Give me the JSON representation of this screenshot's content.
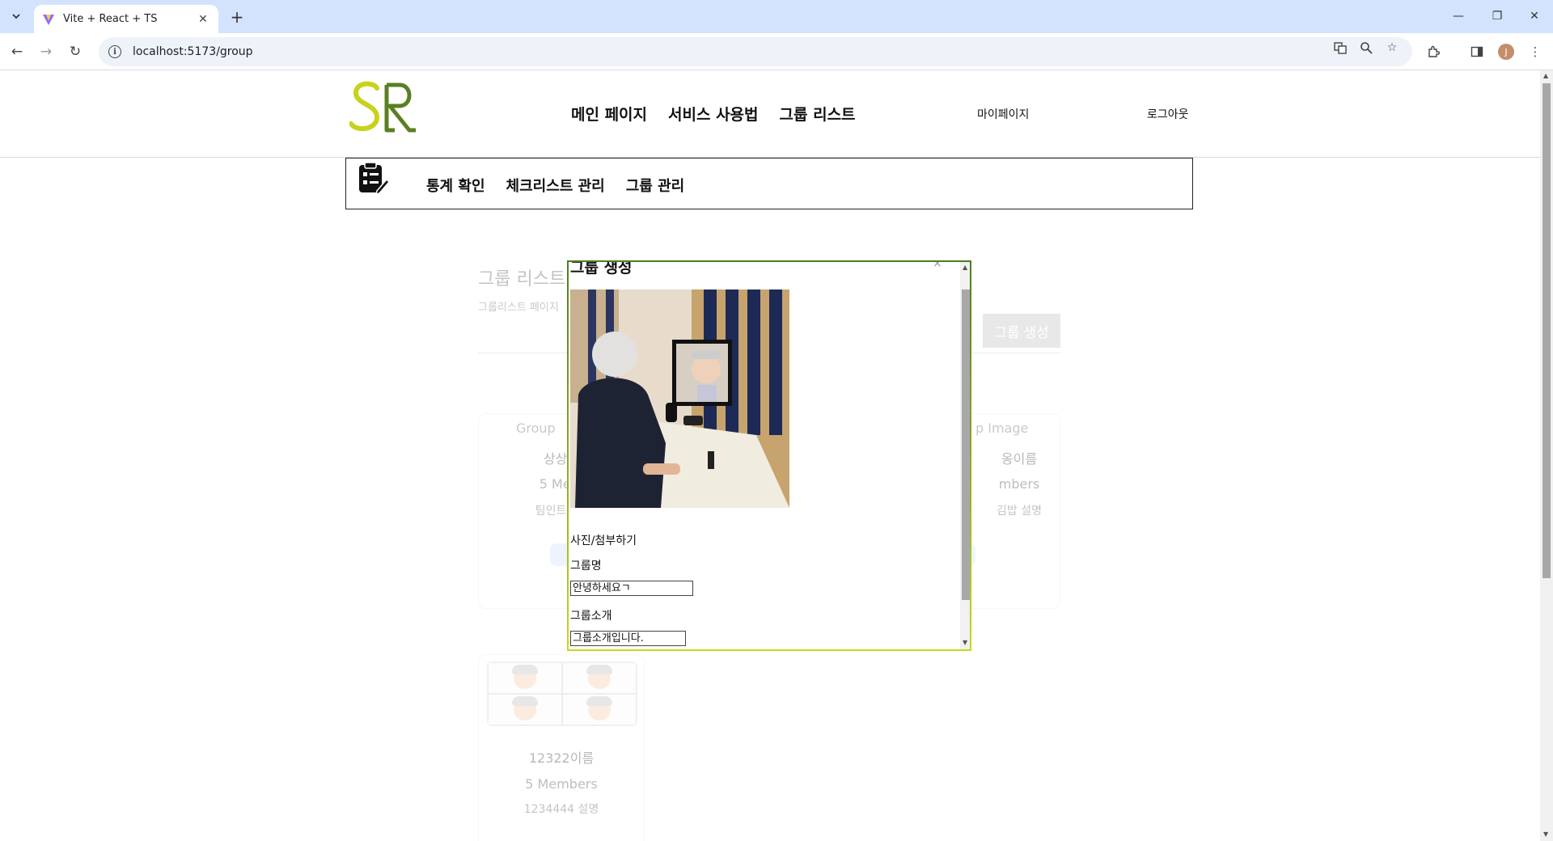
{
  "browser": {
    "tab_title": "Vite + React + TS",
    "url": "localhost:5173/group",
    "profile_initial": "J"
  },
  "header": {
    "nav": [
      "메인 페이지",
      "서비스 사용법",
      "그룹 리스트"
    ],
    "mypage": "마이페이지",
    "logout": "로그아웃"
  },
  "subnav": {
    "items": [
      "통계 확인",
      "체크리스트 관리",
      "그룹 관리"
    ]
  },
  "page": {
    "title": "그룹 리스트",
    "subtitle": "그룹리스트 페이지",
    "create_button": "그룹 생성"
  },
  "cards": [
    {
      "image_alt": "Group",
      "name": "상상옹",
      "members": "5 Mem",
      "desc": "팀인트로어"
    },
    {
      "image_alt": "p Image",
      "name": "옹이름",
      "members": "mbers",
      "desc": "김밥 설명"
    },
    {
      "name": "12322이름",
      "members": "5 Members",
      "desc": "1234444 설명"
    }
  ],
  "modal": {
    "title": "그룹 생성",
    "close": "×",
    "attach_label": "사진/첨부하기",
    "group_name_label": "그룹명",
    "group_name_value": "안녕하세요ㄱ",
    "group_intro_label": "그룹소개",
    "group_intro_value": "그룹소개입니다."
  },
  "colors": {
    "logo_green": "#5a7f22",
    "logo_yellow": "#c8d21c",
    "tab_bar": "#d3e3fd",
    "pill_blue": "#cfe0ff"
  }
}
